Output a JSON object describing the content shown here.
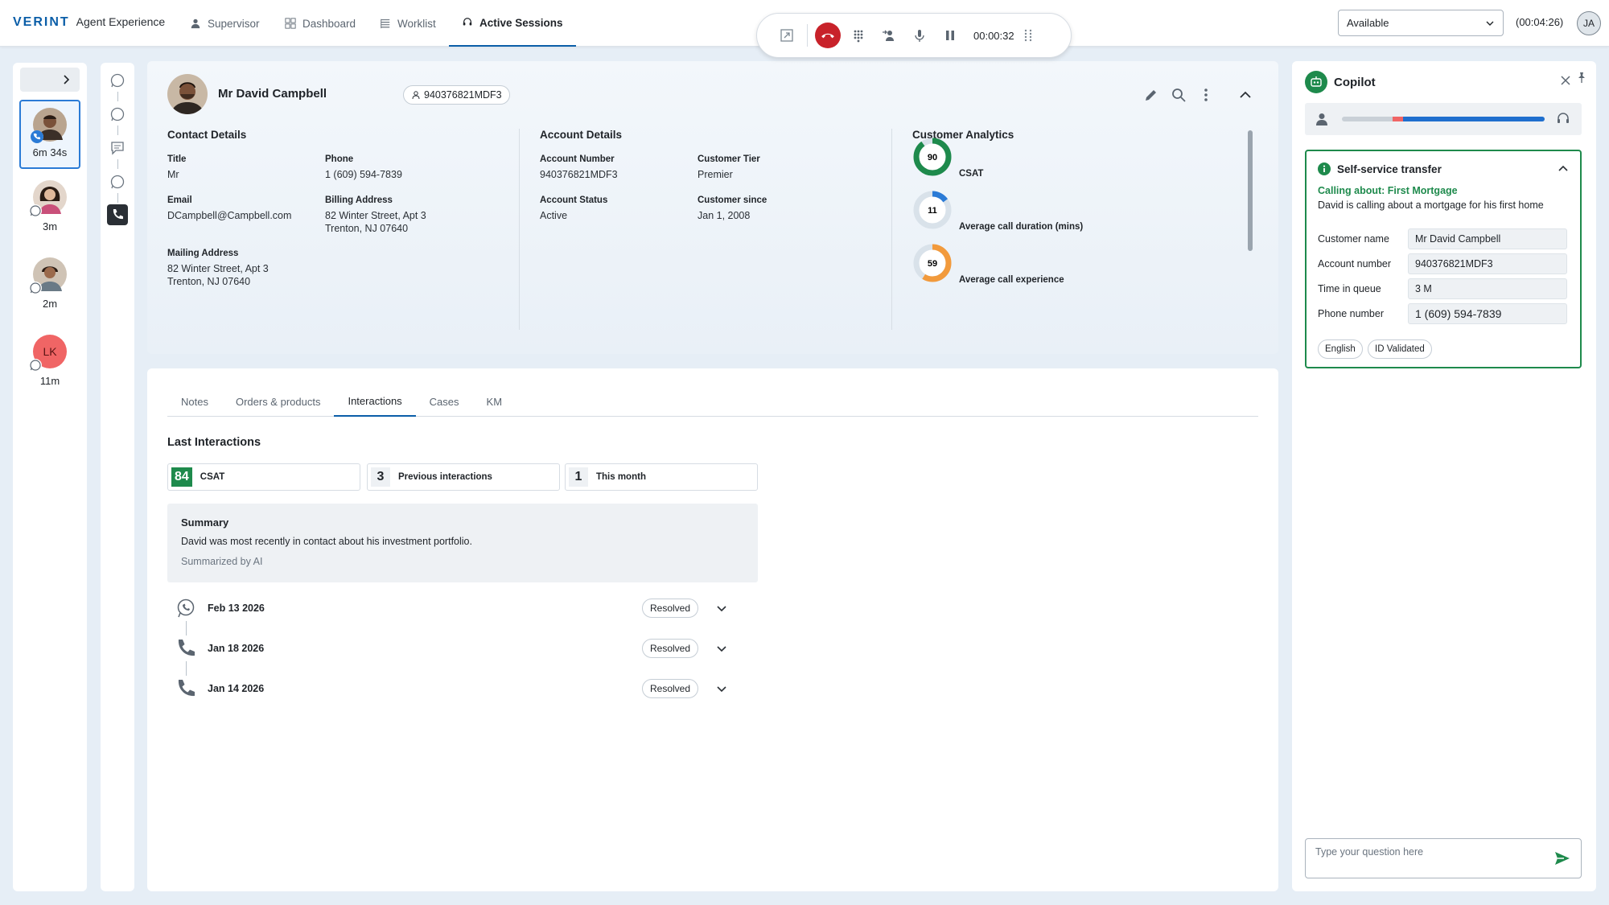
{
  "brand": {
    "logo": "VERINT",
    "app": "Agent Experience"
  },
  "nav": {
    "items": [
      {
        "label": "Supervisor",
        "icon": "person-icon"
      },
      {
        "label": "Dashboard",
        "icon": "grid-icon"
      },
      {
        "label": "Worklist",
        "icon": "list-icon"
      },
      {
        "label": "Active Sessions",
        "icon": "headset-icon",
        "active": true
      }
    ]
  },
  "call_controls": {
    "timer": "00:00:32",
    "buttons": [
      "expand-icon",
      "hang-up-icon",
      "keypad-icon",
      "transfer-icon",
      "mute-icon",
      "pause-icon",
      "drag-handle-icon"
    ]
  },
  "status": {
    "value": "Available",
    "timer": "(00:04:26)"
  },
  "user": {
    "initials": "JA"
  },
  "sessions": [
    {
      "time": "6m 34s",
      "active": true,
      "channel": "phone"
    },
    {
      "time": "3m",
      "channel": "whatsapp"
    },
    {
      "time": "2m",
      "channel": "whatsapp"
    },
    {
      "time": "11m",
      "initials": "LK",
      "channel": "whatsapp"
    }
  ],
  "contact": {
    "name": "Mr David Campbell",
    "account_pill": "940376821MDF3",
    "contact_details": {
      "heading": "Contact Details",
      "title_label": "Title",
      "title": "Mr",
      "phone_label": "Phone",
      "phone": "1 (609) 594-7839",
      "email_label": "Email",
      "email": "DCampbell@Campbell.com",
      "billing_label": "Billing Address",
      "billing_line1": "82 Winter Street, Apt 3",
      "billing_line2": "Trenton, NJ 07640",
      "mailing_label": "Mailing Address",
      "mailing_line1": "82 Winter Street, Apt 3",
      "mailing_line2": "Trenton, NJ 07640"
    },
    "account_details": {
      "heading": "Account Details",
      "number_label": "Account Number",
      "number": "940376821MDF3",
      "tier_label": "Customer Tier",
      "tier": "Premier",
      "status_label": "Account Status",
      "status": "Active",
      "since_label": "Customer since",
      "since": "Jan 1, 2008"
    },
    "analytics": {
      "heading": "Customer Analytics",
      "items": [
        {
          "value": "90",
          "label": "CSAT",
          "fraction": 0.9,
          "color": "#1e8a4c"
        },
        {
          "value": "11",
          "label": "Average call duration (mins)",
          "fraction": 0.15,
          "color": "#2b7bd6"
        },
        {
          "value": "59",
          "label": "Average call experience",
          "fraction": 0.59,
          "color": "#f29a3c"
        }
      ]
    }
  },
  "tabs": [
    "Notes",
    "Orders & products",
    "Interactions",
    "Cases",
    "KM"
  ],
  "active_tab": "Interactions",
  "last_interactions": {
    "title": "Last Interactions",
    "stats": [
      {
        "value": "84",
        "label": "CSAT"
      },
      {
        "value": "3",
        "label": "Previous interactions"
      },
      {
        "value": "1",
        "label": "This month"
      }
    ],
    "summary": {
      "title": "Summary",
      "body": "David was most recently in contact about his investment portfolio.",
      "source": "Summarized by AI"
    },
    "items": [
      {
        "date": "Feb 13 2026",
        "status": "Resolved",
        "channel": "whatsapp"
      },
      {
        "date": "Jan 18 2026",
        "status": "Resolved",
        "channel": "phone"
      },
      {
        "date": "Jan 14 2026",
        "status": "Resolved",
        "channel": "phone"
      }
    ]
  },
  "copilot": {
    "title": "Copilot",
    "progress": {
      "red_start": 0.25,
      "red_end": 0.3,
      "fill_end": 1.0
    },
    "card": {
      "title": "Self-service transfer",
      "about": "Calling about: First Mortgage",
      "desc": "David is calling about a mortgage for his first home",
      "fields": [
        {
          "label": "Customer name",
          "value": "Mr David Campbell"
        },
        {
          "label": "Account number",
          "value": "940376821MDF3"
        },
        {
          "label": "Time in queue",
          "value": "3 M"
        },
        {
          "label": "Phone number",
          "value": "1 (609) 594-7839"
        }
      ],
      "chips": [
        "English",
        "ID Validated"
      ]
    },
    "input_placeholder": "Type your question here"
  },
  "colors": {
    "accent": "#0b5ea8",
    "green": "#1e8a4c",
    "hangup": "#c8222a"
  }
}
